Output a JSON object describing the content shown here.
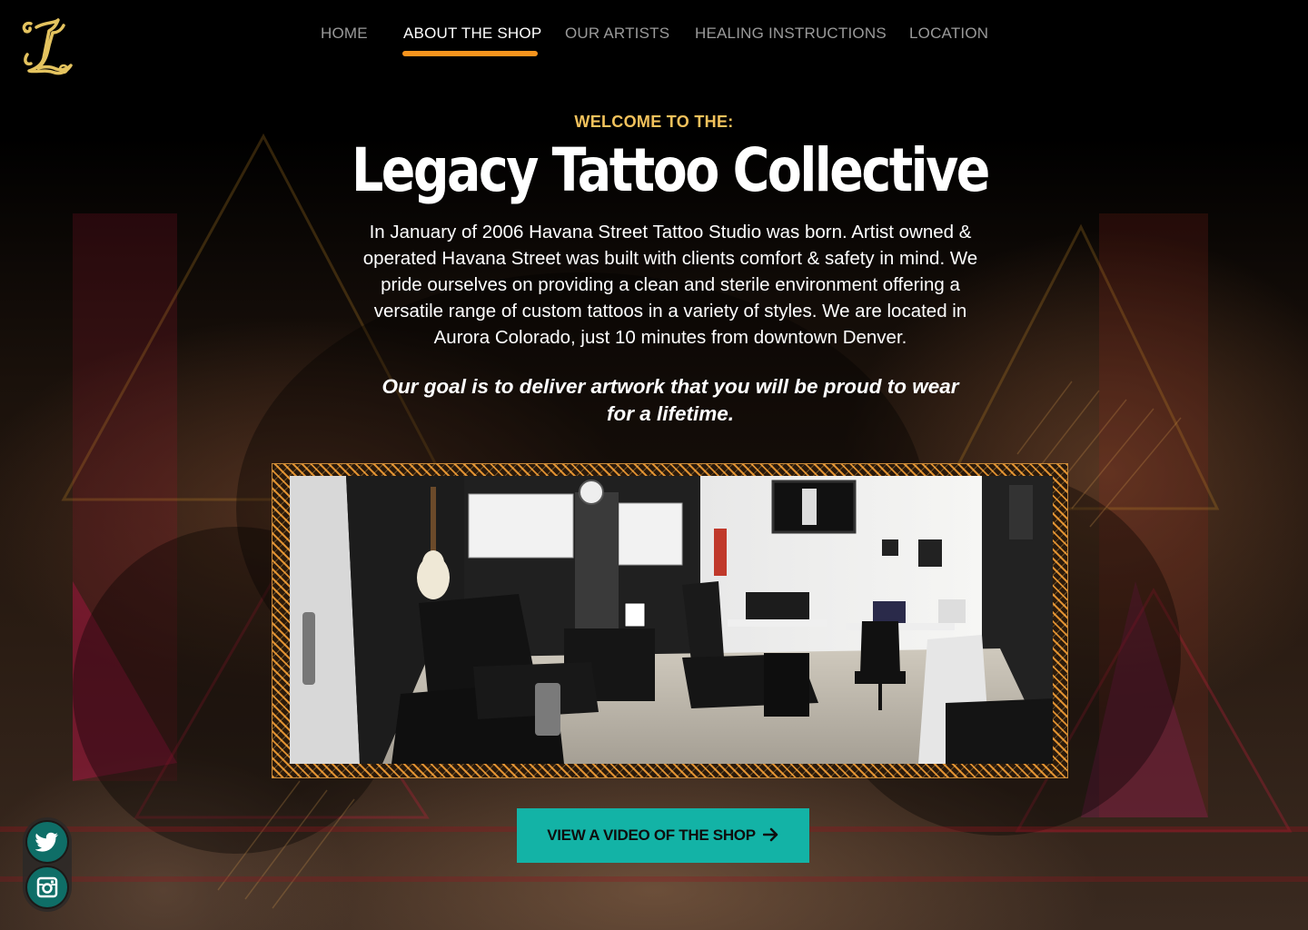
{
  "brand": {
    "logo_letter": "L"
  },
  "nav": {
    "items": [
      {
        "label": "HOME",
        "active": false
      },
      {
        "label": "ABOUT THE SHOP",
        "active": true
      },
      {
        "label": "OUR ARTISTS",
        "active": false
      },
      {
        "label": "HEALING INSTRUCTIONS",
        "active": false
      },
      {
        "label": "LOCATION",
        "active": false
      }
    ],
    "accent_color": "#f7941d"
  },
  "hero": {
    "eyebrow": "WELCOME TO THE:",
    "title": "Legacy Tattoo Collective",
    "intro": "In January of 2006 Havana Street Tattoo Studio was born. Artist owned & operated Havana Street was built with clients comfort & safety in mind. We pride ourselves on providing a clean and sterile environment offering a versatile range of custom tattoos in a variety of styles. We are located in Aurora Colorado, just 10 minutes from downtown Denver.",
    "goal": "Our goal is to deliver artwork that you will be proud to wear for a lifetime.",
    "eyebrow_color": "#f2c25c"
  },
  "cta": {
    "label": "VIEW A VIDEO OF THE SHOP",
    "icon": "arrow-right-icon",
    "color": "#13b3a6"
  },
  "social": [
    {
      "name": "twitter",
      "icon": "twitter-icon"
    },
    {
      "name": "instagram",
      "icon": "instagram-icon"
    }
  ]
}
